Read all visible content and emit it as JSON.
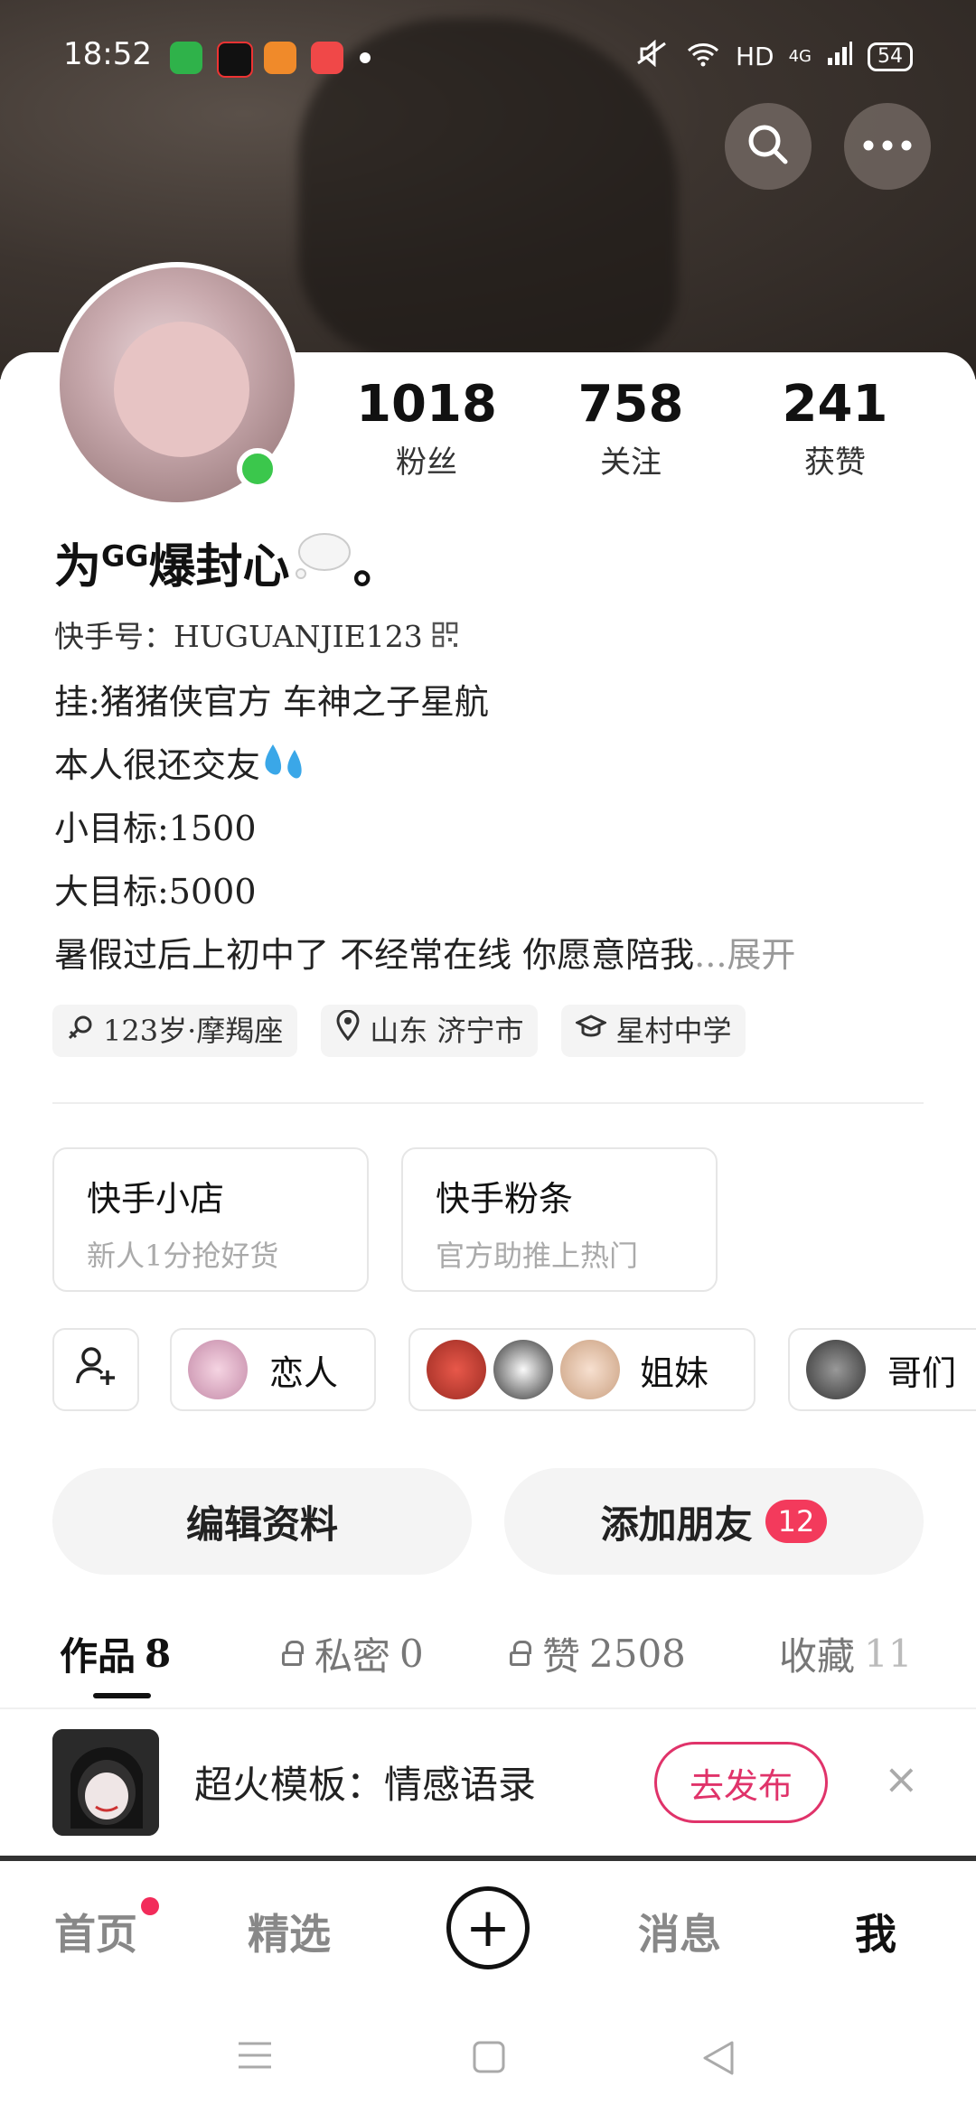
{
  "status_bar": {
    "time": "18:52",
    "hd": "HD",
    "network": "4G",
    "battery": "54"
  },
  "profile": {
    "name_a": "为",
    "name_sup": "GG",
    "name_b": "爆封心",
    "name_c": "。",
    "id_line": "快手号：HUGUANJIE123",
    "bio": [
      "挂:猪猪侠官方  车神之子星航",
      "本人很还交友",
      "小目标:1500",
      "大目标:5000"
    ],
    "bio_truncated": "暑假过后上初中了  不经常在线 你愿意陪我",
    "expand_label": "...展开"
  },
  "stats": [
    {
      "num": "1018",
      "label": "粉丝"
    },
    {
      "num": "758",
      "label": "关注"
    },
    {
      "num": "241",
      "label": "获赞"
    }
  ],
  "tags": [
    "123岁·摩羯座",
    "山东 济宁市",
    "星村中学"
  ],
  "shops": [
    {
      "title": "快手小店",
      "sub": "新人1分抢好货"
    },
    {
      "title": "快手粉条",
      "sub": "官方助推上热门"
    }
  ],
  "groups": [
    "恋人",
    "姐妹",
    "哥们"
  ],
  "actions": {
    "edit": "编辑资料",
    "add_friend": "添加朋友",
    "add_friend_badge": "12"
  },
  "tabs": [
    {
      "label": "作品",
      "count": "8"
    },
    {
      "label": "私密",
      "count": "0"
    },
    {
      "label": "赞",
      "count": "2508"
    },
    {
      "label": "收藏",
      "count": "11"
    }
  ],
  "promo": {
    "text": "超火模板：情感语录",
    "button": "去发布",
    "close": "×"
  },
  "bottom_nav": [
    "首页",
    "精选",
    "消息",
    "我"
  ],
  "plus": "+",
  "colors": {
    "accent": "#e0336a",
    "badge": "#f33a5c",
    "online": "#3bc74c"
  }
}
